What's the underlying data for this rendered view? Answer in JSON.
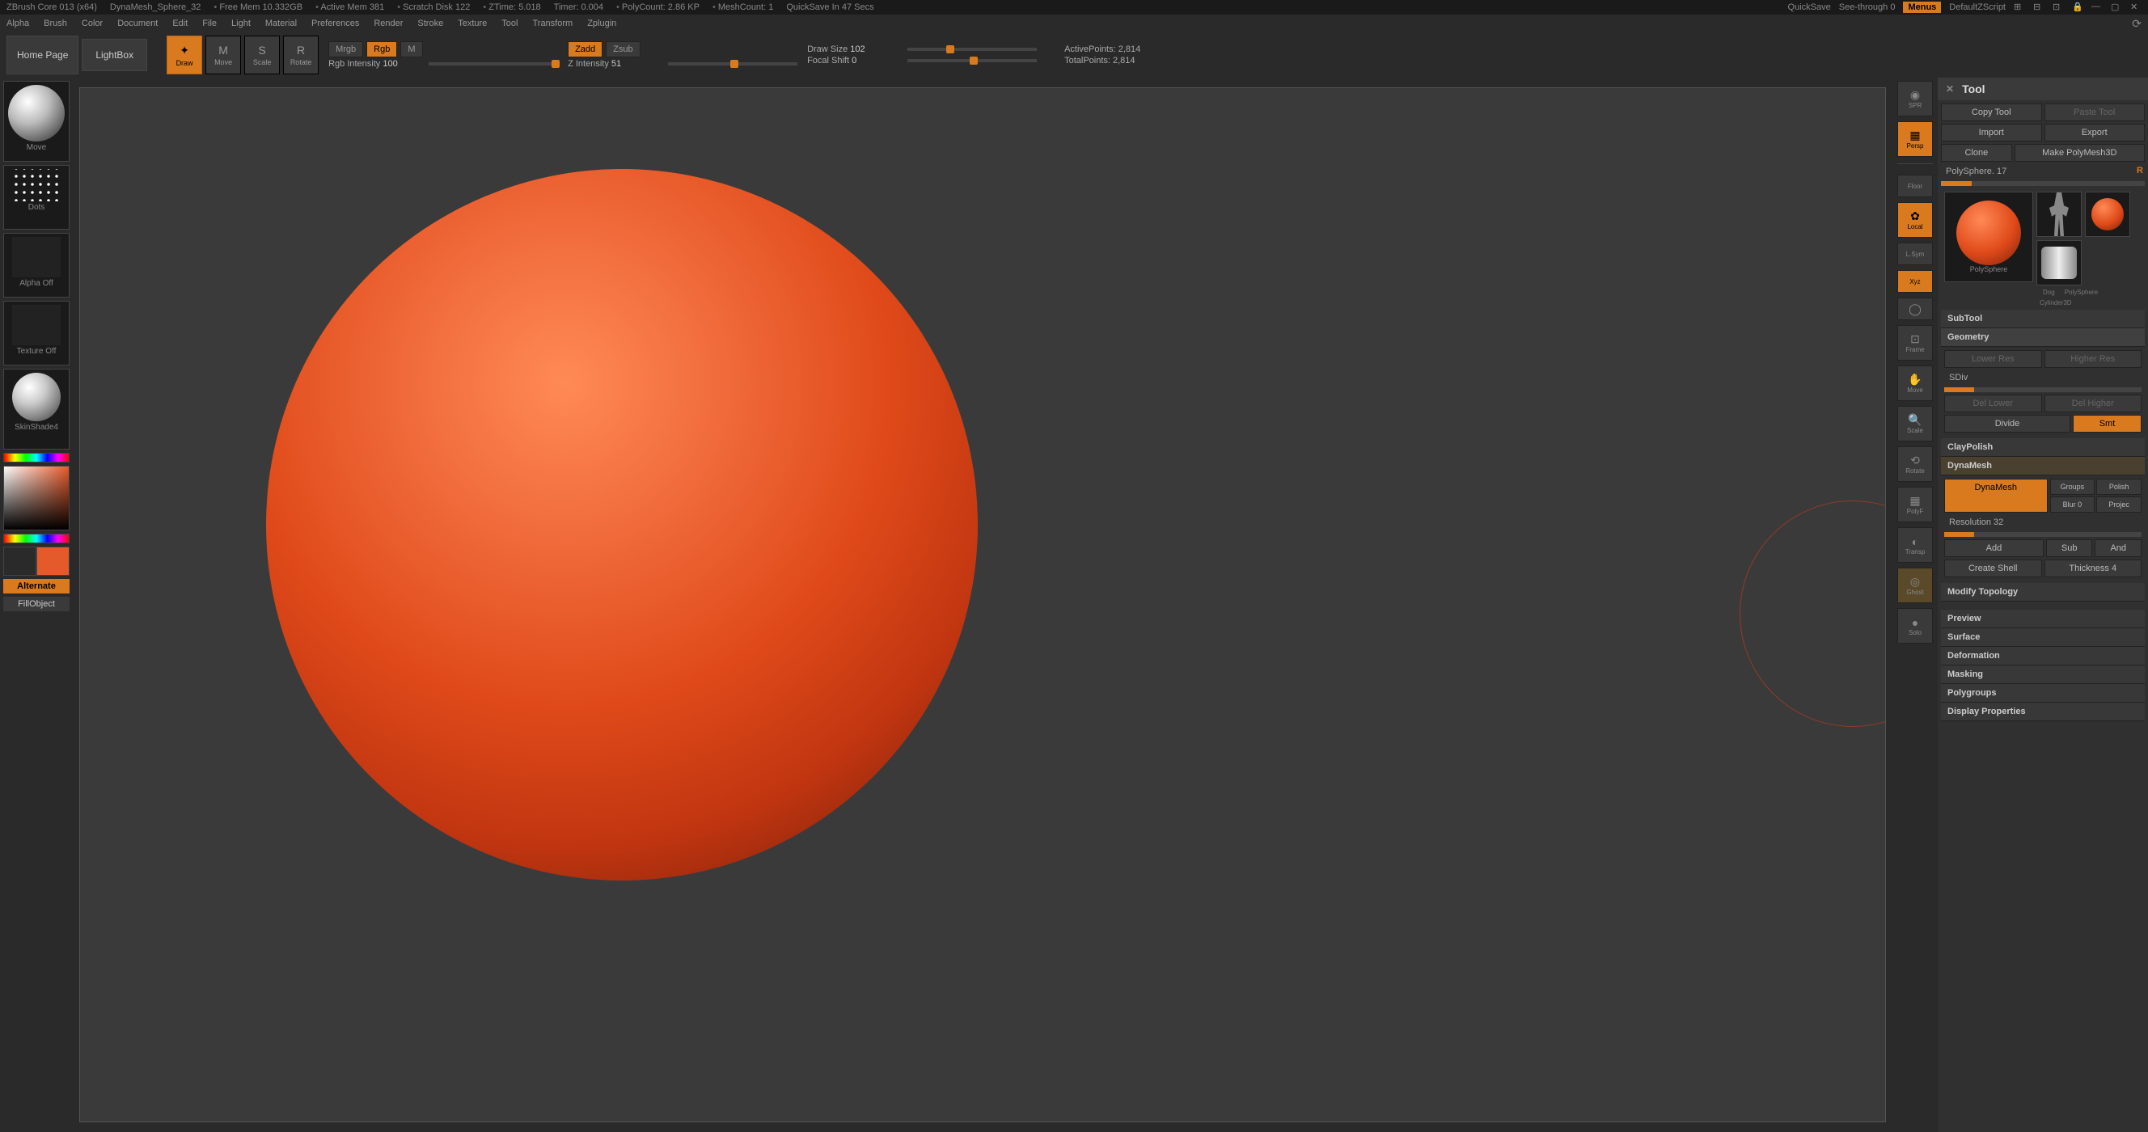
{
  "titlebar": {
    "app": "ZBrush Core 013 (x64)",
    "doc": "DynaMesh_Sphere_32",
    "freemem": "Free Mem 10.332GB",
    "activemem": "Active Mem 381",
    "scratch": "Scratch Disk 122",
    "ztime": "ZTime: 5.018",
    "timer": "Timer: 0.004",
    "polycount": "PolyCount: 2.86 KP",
    "meshcount": "MeshCount: 1",
    "quicksave_in": "QuickSave In 47 Secs",
    "quicksave": "QuickSave",
    "seethrough": "See-through  0",
    "menus": "Menus",
    "defscript": "DefaultZScript"
  },
  "menu": {
    "items": [
      "Alpha",
      "Brush",
      "Color",
      "Document",
      "Edit",
      "File",
      "Light",
      "Material",
      "Preferences",
      "Render",
      "Stroke",
      "Texture",
      "Tool",
      "Transform",
      "Zplugin"
    ]
  },
  "topbar": {
    "home": "Home Page",
    "lightbox": "LightBox",
    "modes": [
      {
        "label": "Draw",
        "active": true
      },
      {
        "label": "Move",
        "active": false
      },
      {
        "label": "Scale",
        "active": false
      },
      {
        "label": "Rotate",
        "active": false
      }
    ],
    "mrgb": "Mrgb",
    "rgb": "Rgb",
    "m": "M",
    "rgb_intensity_label": "Rgb Intensity",
    "rgb_intensity_val": "100",
    "zadd": "Zadd",
    "zsub": "Zsub",
    "z_intensity_label": "Z Intensity",
    "z_intensity_val": "51",
    "drawsize_label": "Draw Size",
    "drawsize_val": "102",
    "focal_label": "Focal Shift",
    "focal_val": "0",
    "active_pts": "ActivePoints: 2,814",
    "total_pts": "TotalPoints: 2,814"
  },
  "left": {
    "brush": "Move",
    "stroke": "Dots",
    "alpha": "Alpha Off",
    "texture": "Texture Off",
    "material": "SkinShade4",
    "alternate": "Alternate",
    "fill": "FillObject"
  },
  "rightstrip": {
    "spr": "SPR",
    "persp": "Persp",
    "floor": "Floor",
    "local": "Local",
    "lsym": "L.Sym",
    "xyz": "Xyz",
    "frame": "Frame",
    "move": "Move",
    "scale": "Scale",
    "rotate": "Rotate",
    "polyf": "PolyF",
    "transp": "Transp",
    "ghost": "Ghost",
    "solo": "Solo"
  },
  "tool": {
    "title": "Tool",
    "copy": "Copy Tool",
    "paste": "Paste Tool",
    "import": "Import",
    "export": "Export",
    "clone": "Clone",
    "makepoly": "Make PolyMesh3D",
    "current": "PolySphere. 17",
    "r": "R",
    "thumbs": {
      "main": "PolySphere",
      "dog": "Dog",
      "poly2": "PolySphere",
      "cyl": "Cylinder3D"
    },
    "sections": {
      "subtool": "SubTool",
      "geometry": "Geometry",
      "geo": {
        "lower": "Lower Res",
        "higher": "Higher Res",
        "sdiv": "SDiv",
        "dellower": "Del Lower",
        "delhigher": "Del Higher",
        "divide": "Divide",
        "smt": "Smt"
      },
      "claypolish": "ClayPolish",
      "dynamesh": "DynaMesh",
      "dyn": {
        "btn": "DynaMesh",
        "groups": "Groups",
        "polish": "Polish",
        "blur": "Blur 0",
        "project": "Projec",
        "res": "Resolution 32",
        "add": "Add",
        "sub": "Sub",
        "and": "And",
        "shell": "Create Shell",
        "thick": "Thickness 4"
      },
      "modtopo": "Modify Topology",
      "preview": "Preview",
      "surface": "Surface",
      "deformation": "Deformation",
      "masking": "Masking",
      "polygroups": "Polygroups",
      "display": "Display Properties"
    }
  }
}
